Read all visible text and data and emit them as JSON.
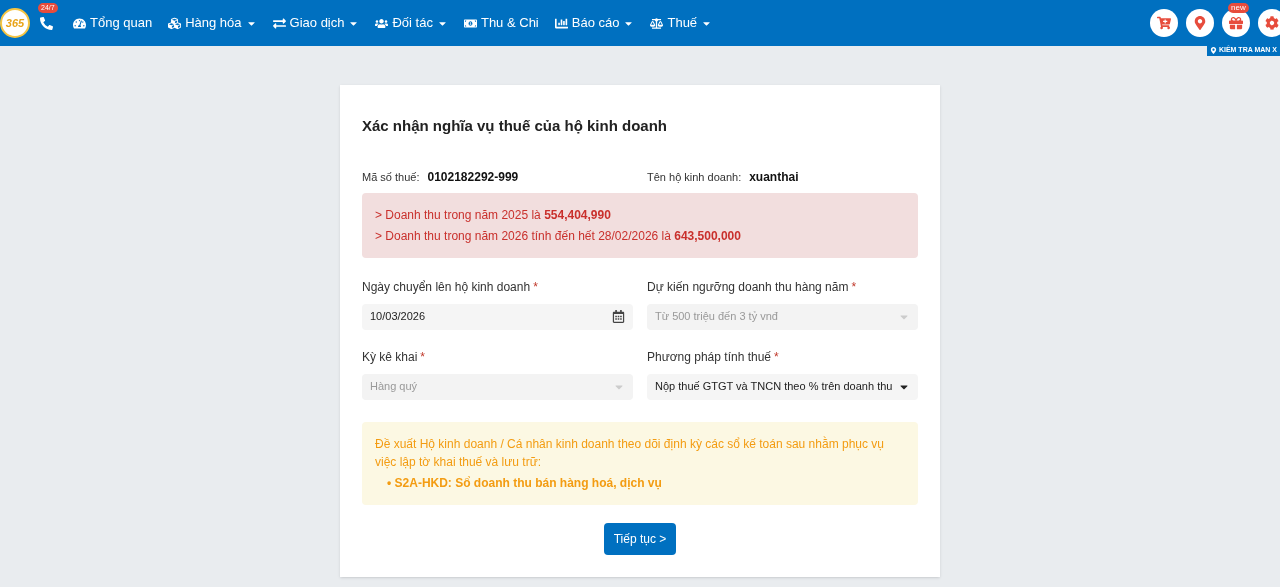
{
  "header": {
    "logo": "365",
    "phone_badge": "24/7",
    "nav": [
      {
        "label": "Tổng quan",
        "caret": false
      },
      {
        "label": "Hàng hóa",
        "caret": true
      },
      {
        "label": "Giao dịch",
        "caret": true
      },
      {
        "label": "Đối tác",
        "caret": true
      },
      {
        "label": "Thu & Chi",
        "caret": false
      },
      {
        "label": "Báo cáo",
        "caret": true
      },
      {
        "label": "Thuế",
        "caret": true
      }
    ],
    "gift_badge": "new",
    "location_label": "KIỂM TRA MAN X"
  },
  "card": {
    "title": "Xác nhận nghĩa vụ thuế của hộ kinh doanh",
    "info": [
      {
        "label": "Mã số thuế:",
        "value": "0102182292-999"
      },
      {
        "label": "Tên hộ kinh doanh:",
        "value": "xuanthai"
      }
    ],
    "alert_lines": [
      "> Doanh thu trong năm 2025 là **554,404,990**",
      "> Doanh thu trong năm 2026 tính đến hết 28/02/2026 là **643,500,000**"
    ],
    "fields": [
      {
        "label": "Ngày chuyển lên hộ kinh doanh",
        "required_mark": "*",
        "kind": "date",
        "value": "10/03/2026",
        "disabled": false
      },
      {
        "label": "Dự kiến ngưỡng doanh thu hàng năm",
        "required_mark": "*",
        "kind": "select",
        "value": "Từ 500 triệu đến 3 tỷ vnđ",
        "disabled": true
      },
      {
        "label": "Kỳ kê khai",
        "required_mark": "*",
        "kind": "select",
        "value": "Hàng quý",
        "disabled": true
      },
      {
        "label": "Phương pháp tính thuế",
        "required_mark": "*",
        "kind": "select",
        "value": "Nộp thuế GTGT và TNCN theo % trên doanh thu",
        "disabled": false
      }
    ],
    "note": {
      "text": "Đề xuất Hộ kinh doanh / Cá nhân kinh doanh theo dõi định kỳ các sổ kế toán sau nhằm phục vụ việc lập tờ khai thuế và lưu trữ:",
      "items": [
        "• S2A-HKD: Sổ doanh thu bán hàng hoá, dịch vụ"
      ]
    },
    "button": "Tiếp tục >"
  }
}
